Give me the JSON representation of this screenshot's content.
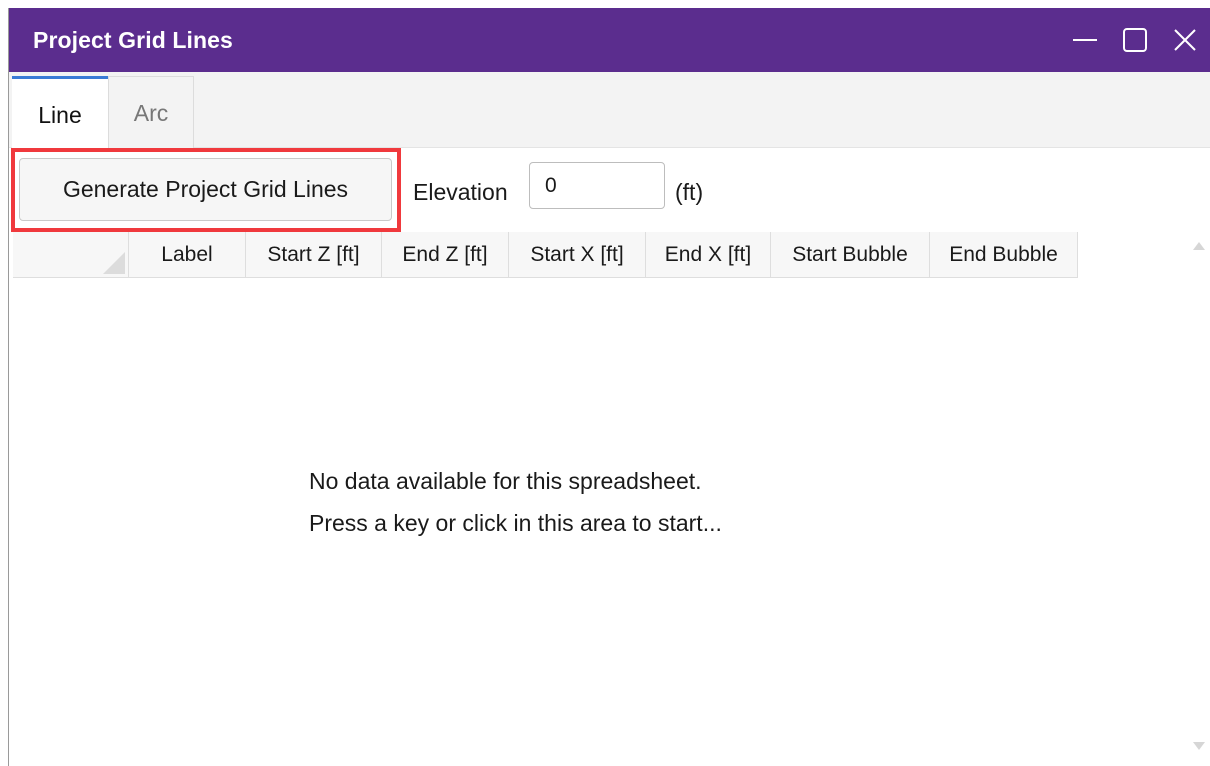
{
  "window": {
    "title": "Project Grid Lines",
    "title_bar_color": "#5b2d8e",
    "controls": [
      "minimize-icon",
      "maximize-icon",
      "close-icon"
    ]
  },
  "tabs": [
    {
      "label": "Line",
      "active": true
    },
    {
      "label": "Arc",
      "active": false
    }
  ],
  "toolbar": {
    "generate_label": "Generate Project Grid Lines",
    "elevation_label": "Elevation",
    "elevation_value": "0",
    "unit_label": "(ft)",
    "highlight_color": "#f0393d"
  },
  "grid": {
    "columns": [
      "Label",
      "Start Z [ft]",
      "End Z [ft]",
      "Start X [ft]",
      "End X [ft]",
      "Start Bubble",
      "End Bubble"
    ],
    "rows": [],
    "empty_line1": "No data available for this spreadsheet.",
    "empty_line2": "Press a key or click in this area to start..."
  }
}
